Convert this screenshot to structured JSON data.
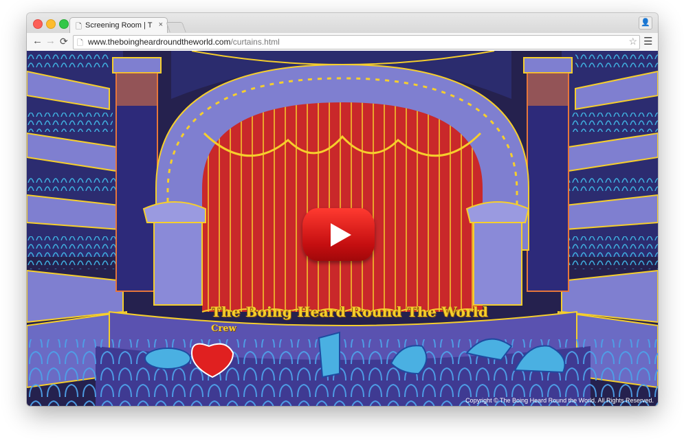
{
  "browser": {
    "tab_title": "Screening Room | The Boing Heard Round The World",
    "tab_close": "×",
    "url_domain": "www.theboingheardroundtheworld.com",
    "url_path": "/curtains.html",
    "icons": [
      "page-icon",
      "close-icon",
      "back-arrow-icon",
      "forward-arrow-icon",
      "reload-icon",
      "star-icon",
      "menu-icon",
      "profile-icon"
    ]
  },
  "page": {
    "show_title": "The Boing Heard Round The World",
    "crew_link": "Crew",
    "copyright": "Copyright © The Boing Heard Round the World. All Rights Reserved.",
    "video_button": "play-button",
    "colors": {
      "curtain": "#c9282a",
      "curtain_trim": "#f6cf2c",
      "arch": "#7f7fd0",
      "background": "#25214e",
      "play_red": "#e0201b",
      "hats": "#4ab0e2",
      "heart": "#e02020"
    }
  }
}
